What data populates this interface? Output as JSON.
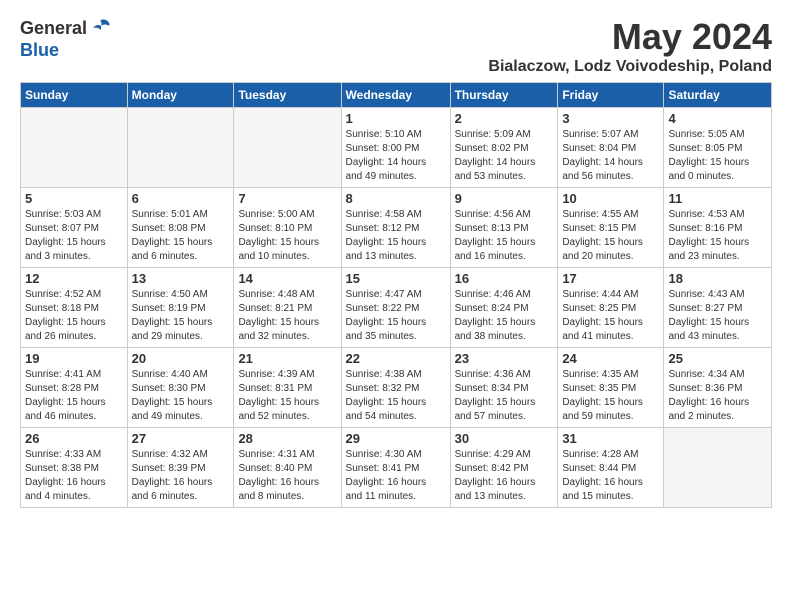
{
  "header": {
    "logo_general": "General",
    "logo_blue": "Blue",
    "month_title": "May 2024",
    "location": "Bialaczow, Lodz Voivodeship, Poland"
  },
  "weekdays": [
    "Sunday",
    "Monday",
    "Tuesday",
    "Wednesday",
    "Thursday",
    "Friday",
    "Saturday"
  ],
  "weeks": [
    [
      {
        "day": "",
        "empty": true
      },
      {
        "day": "",
        "empty": true
      },
      {
        "day": "",
        "empty": true
      },
      {
        "day": "1",
        "sunrise": "5:10 AM",
        "sunset": "8:00 PM",
        "daylight": "14 hours and 49 minutes."
      },
      {
        "day": "2",
        "sunrise": "5:09 AM",
        "sunset": "8:02 PM",
        "daylight": "14 hours and 53 minutes."
      },
      {
        "day": "3",
        "sunrise": "5:07 AM",
        "sunset": "8:04 PM",
        "daylight": "14 hours and 56 minutes."
      },
      {
        "day": "4",
        "sunrise": "5:05 AM",
        "sunset": "8:05 PM",
        "daylight": "15 hours and 0 minutes."
      }
    ],
    [
      {
        "day": "5",
        "sunrise": "5:03 AM",
        "sunset": "8:07 PM",
        "daylight": "15 hours and 3 minutes."
      },
      {
        "day": "6",
        "sunrise": "5:01 AM",
        "sunset": "8:08 PM",
        "daylight": "15 hours and 6 minutes."
      },
      {
        "day": "7",
        "sunrise": "5:00 AM",
        "sunset": "8:10 PM",
        "daylight": "15 hours and 10 minutes."
      },
      {
        "day": "8",
        "sunrise": "4:58 AM",
        "sunset": "8:12 PM",
        "daylight": "15 hours and 13 minutes."
      },
      {
        "day": "9",
        "sunrise": "4:56 AM",
        "sunset": "8:13 PM",
        "daylight": "15 hours and 16 minutes."
      },
      {
        "day": "10",
        "sunrise": "4:55 AM",
        "sunset": "8:15 PM",
        "daylight": "15 hours and 20 minutes."
      },
      {
        "day": "11",
        "sunrise": "4:53 AM",
        "sunset": "8:16 PM",
        "daylight": "15 hours and 23 minutes."
      }
    ],
    [
      {
        "day": "12",
        "sunrise": "4:52 AM",
        "sunset": "8:18 PM",
        "daylight": "15 hours and 26 minutes."
      },
      {
        "day": "13",
        "sunrise": "4:50 AM",
        "sunset": "8:19 PM",
        "daylight": "15 hours and 29 minutes."
      },
      {
        "day": "14",
        "sunrise": "4:48 AM",
        "sunset": "8:21 PM",
        "daylight": "15 hours and 32 minutes."
      },
      {
        "day": "15",
        "sunrise": "4:47 AM",
        "sunset": "8:22 PM",
        "daylight": "15 hours and 35 minutes."
      },
      {
        "day": "16",
        "sunrise": "4:46 AM",
        "sunset": "8:24 PM",
        "daylight": "15 hours and 38 minutes."
      },
      {
        "day": "17",
        "sunrise": "4:44 AM",
        "sunset": "8:25 PM",
        "daylight": "15 hours and 41 minutes."
      },
      {
        "day": "18",
        "sunrise": "4:43 AM",
        "sunset": "8:27 PM",
        "daylight": "15 hours and 43 minutes."
      }
    ],
    [
      {
        "day": "19",
        "sunrise": "4:41 AM",
        "sunset": "8:28 PM",
        "daylight": "15 hours and 46 minutes."
      },
      {
        "day": "20",
        "sunrise": "4:40 AM",
        "sunset": "8:30 PM",
        "daylight": "15 hours and 49 minutes."
      },
      {
        "day": "21",
        "sunrise": "4:39 AM",
        "sunset": "8:31 PM",
        "daylight": "15 hours and 52 minutes."
      },
      {
        "day": "22",
        "sunrise": "4:38 AM",
        "sunset": "8:32 PM",
        "daylight": "15 hours and 54 minutes."
      },
      {
        "day": "23",
        "sunrise": "4:36 AM",
        "sunset": "8:34 PM",
        "daylight": "15 hours and 57 minutes."
      },
      {
        "day": "24",
        "sunrise": "4:35 AM",
        "sunset": "8:35 PM",
        "daylight": "15 hours and 59 minutes."
      },
      {
        "day": "25",
        "sunrise": "4:34 AM",
        "sunset": "8:36 PM",
        "daylight": "16 hours and 2 minutes."
      }
    ],
    [
      {
        "day": "26",
        "sunrise": "4:33 AM",
        "sunset": "8:38 PM",
        "daylight": "16 hours and 4 minutes."
      },
      {
        "day": "27",
        "sunrise": "4:32 AM",
        "sunset": "8:39 PM",
        "daylight": "16 hours and 6 minutes."
      },
      {
        "day": "28",
        "sunrise": "4:31 AM",
        "sunset": "8:40 PM",
        "daylight": "16 hours and 8 minutes."
      },
      {
        "day": "29",
        "sunrise": "4:30 AM",
        "sunset": "8:41 PM",
        "daylight": "16 hours and 11 minutes."
      },
      {
        "day": "30",
        "sunrise": "4:29 AM",
        "sunset": "8:42 PM",
        "daylight": "16 hours and 13 minutes."
      },
      {
        "day": "31",
        "sunrise": "4:28 AM",
        "sunset": "8:44 PM",
        "daylight": "16 hours and 15 minutes."
      },
      {
        "day": "",
        "empty": true
      }
    ]
  ]
}
